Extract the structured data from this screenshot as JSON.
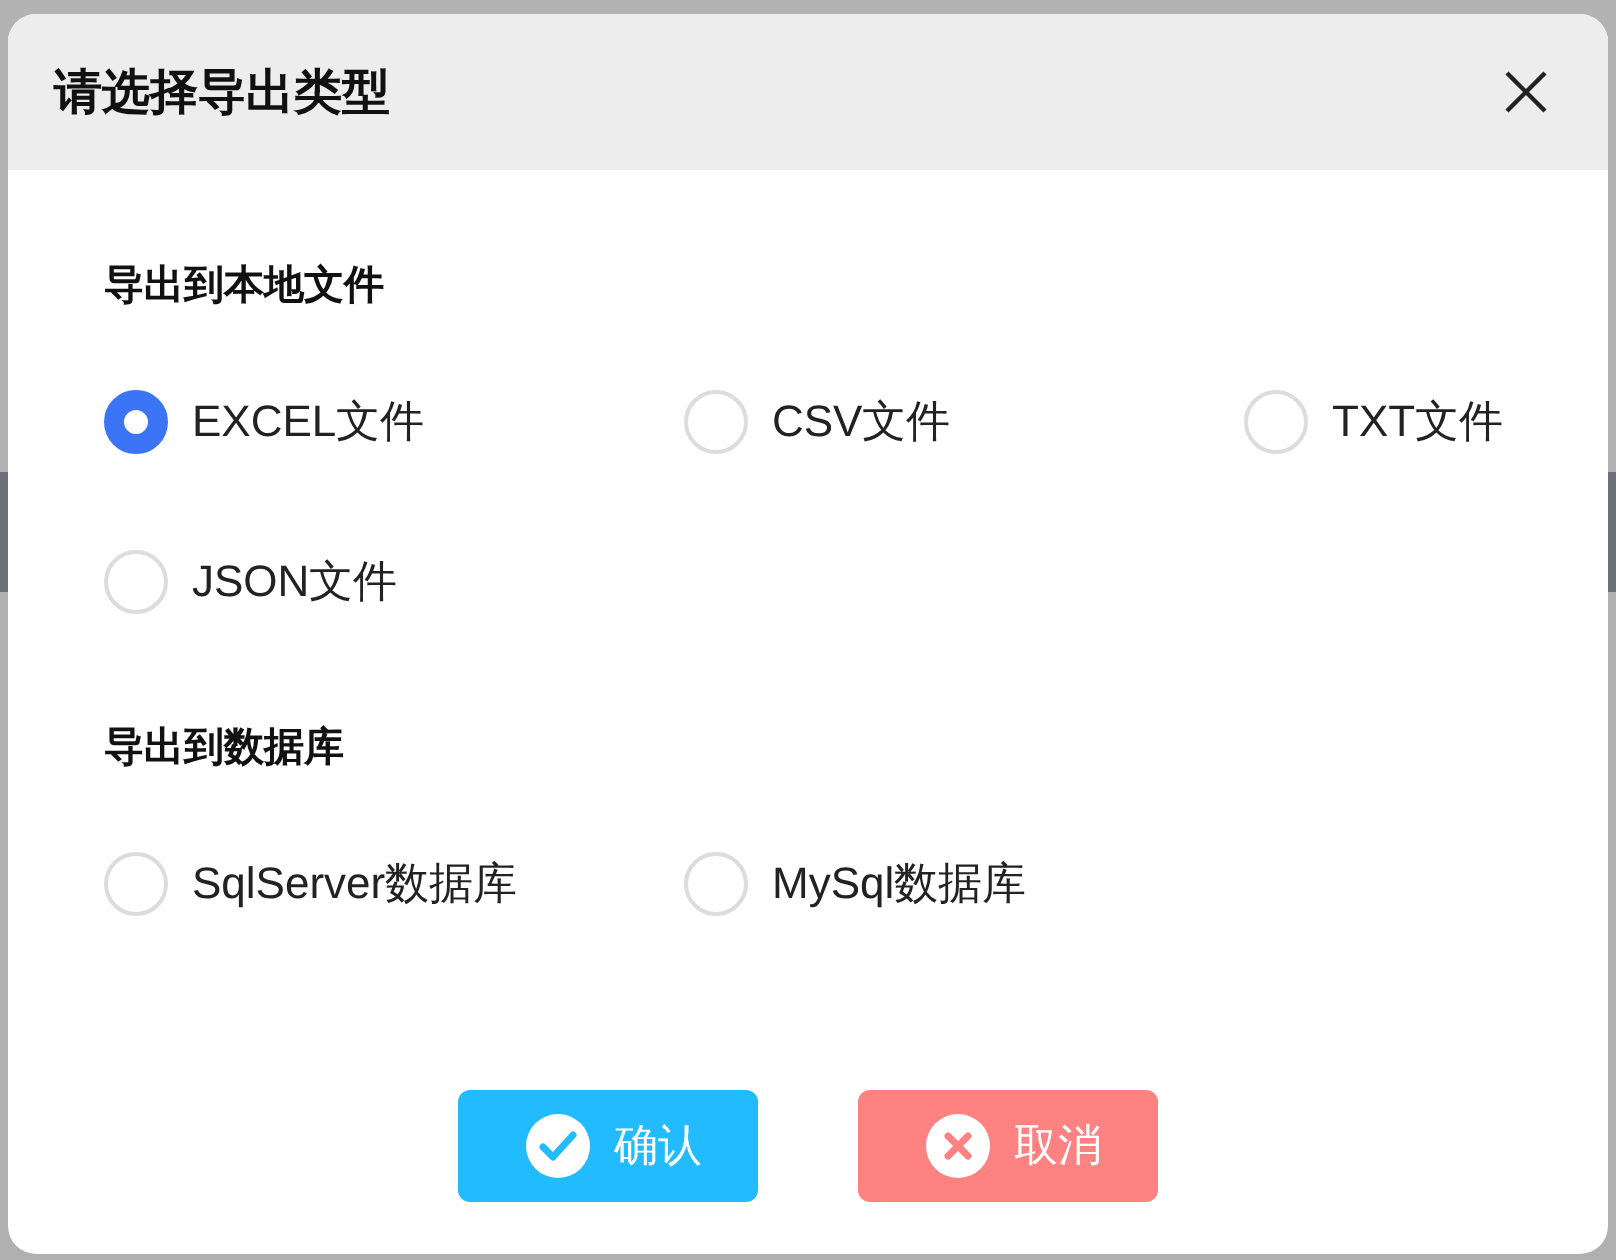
{
  "dialog": {
    "title": "请选择导出类型"
  },
  "sections": [
    {
      "title": "导出到本地文件",
      "options": [
        {
          "label": "EXCEL文件",
          "selected": true
        },
        {
          "label": "CSV文件",
          "selected": false
        },
        {
          "label": "TXT文件",
          "selected": false
        },
        {
          "label": "JSON文件",
          "selected": false
        }
      ]
    },
    {
      "title": "导出到数据库",
      "options": [
        {
          "label": "SqlServer数据库",
          "selected": false
        },
        {
          "label": "MySql数据库",
          "selected": false
        }
      ]
    }
  ],
  "buttons": [
    {
      "label": "确认",
      "kind": "confirm"
    },
    {
      "label": "取消",
      "kind": "cancel"
    }
  ]
}
